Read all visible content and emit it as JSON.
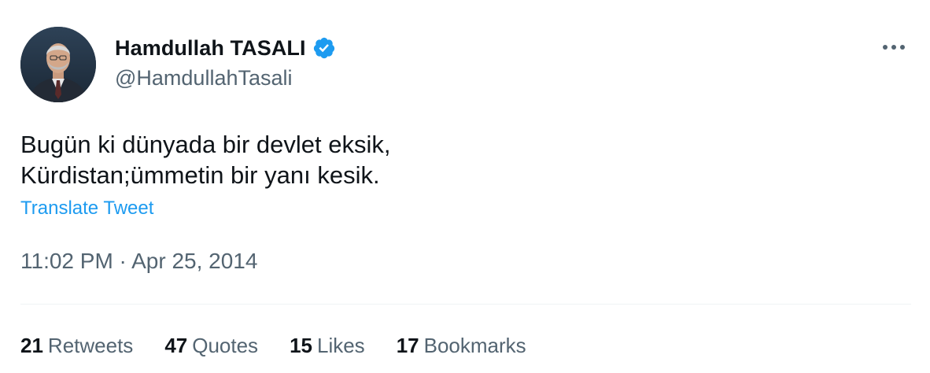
{
  "author": {
    "display_name": "Hamdullah TASALI",
    "handle": "@HamdullahTasali",
    "verified_icon": "verified-badge-icon",
    "avatar_icon": "profile-photo"
  },
  "more_icon": "more-options-icon",
  "tweet": {
    "text": "Bugün ki dünyada bir devlet eksik,\nKürdistan;ümmetin bir yanı kesik.",
    "translate_label": "Translate Tweet",
    "timestamp": "11:02 PM · Apr 25, 2014"
  },
  "stats": [
    {
      "count": "21",
      "label": "Retweets"
    },
    {
      "count": "47",
      "label": "Quotes"
    },
    {
      "count": "15",
      "label": "Likes"
    },
    {
      "count": "17",
      "label": "Bookmarks"
    }
  ],
  "colors": {
    "accent": "#1d9bf0",
    "text_primary": "#0f1419",
    "text_secondary": "#536471",
    "divider": "#eff3f4"
  }
}
